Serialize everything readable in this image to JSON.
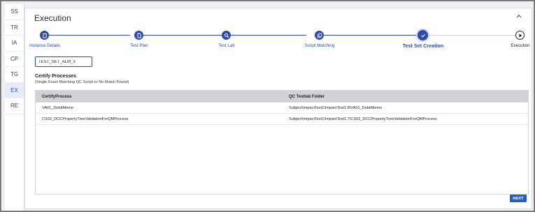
{
  "sidebar": {
    "items": [
      {
        "label": "SS",
        "active": false
      },
      {
        "label": "TR",
        "active": false
      },
      {
        "label": "IA",
        "active": false
      },
      {
        "label": "CP",
        "active": false
      },
      {
        "label": "TG",
        "active": false
      },
      {
        "label": "EX",
        "active": true
      },
      {
        "label": "RE",
        "active": false
      }
    ]
  },
  "panel": {
    "title": "Execution",
    "collapse_icon": "chevron-up-icon"
  },
  "stepper": {
    "steps": [
      {
        "label": "Instance Details",
        "icon": "clipboard-icon",
        "state": "done"
      },
      {
        "label": "Test Plan",
        "icon": "document-icon",
        "state": "done"
      },
      {
        "label": "Test Lab",
        "icon": "search-icon",
        "state": "done"
      },
      {
        "label": "Script Matching",
        "icon": "copy-icon",
        "state": "done"
      },
      {
        "label": "Test Set Creation",
        "icon": "check-icon",
        "state": "current"
      },
      {
        "label": "Execution",
        "icon": "play-icon",
        "state": "future"
      }
    ],
    "accent_color": "#2d4ba7"
  },
  "test_set": {
    "value": "TEST_SET_ALM_3"
  },
  "certify": {
    "title": "Certify Processes",
    "subtitle": "(Single Exact Matching QC Script or No Match Found)",
    "columns": [
      "CertifyProcess",
      "QC Testlab Folder"
    ],
    "rows": [
      [
        "VA01_DebitMemo",
        "Subject\\ImpactTest1\\ImpactTest2.8\\VA01_DebitMemo"
      ],
      [
        "CS02_DCCPropertyTreeValidationForQMProcess",
        "Subject\\ImpactTest1\\ImpactTest2.7\\CS02_DCCPropertyTreeValidationForQMProcess"
      ]
    ]
  },
  "actions": {
    "next_label": "NEXT",
    "button_color": "#1e5fc4"
  }
}
